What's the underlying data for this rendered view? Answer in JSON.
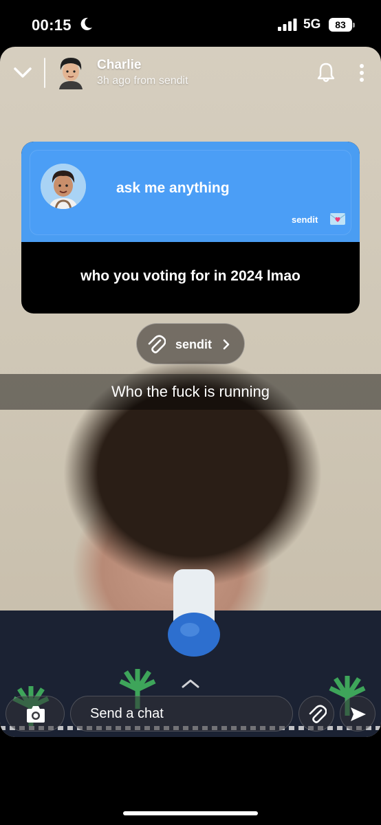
{
  "status_bar": {
    "time": "00:15",
    "focus_icon": "moon-icon",
    "network": "5G",
    "battery": "83"
  },
  "header": {
    "sender_name": "Charlie",
    "subtitle": "3h ago from sendit",
    "back_icon": "chevron-down-icon",
    "bell_icon": "bell-icon",
    "more_icon": "more-vertical-icon"
  },
  "card": {
    "prompt": "ask me anything",
    "brand": "sendit",
    "question": "who you voting for in 2024 lmao",
    "accent_color": "#4a9df2"
  },
  "sendit_pill": {
    "label": "sendit"
  },
  "caption": "Who the fuck is running",
  "chat_bar": {
    "placeholder": "Send a chat",
    "camera_icon": "camera-icon",
    "attach_icon": "paperclip-icon",
    "send_icon": "send-icon"
  }
}
